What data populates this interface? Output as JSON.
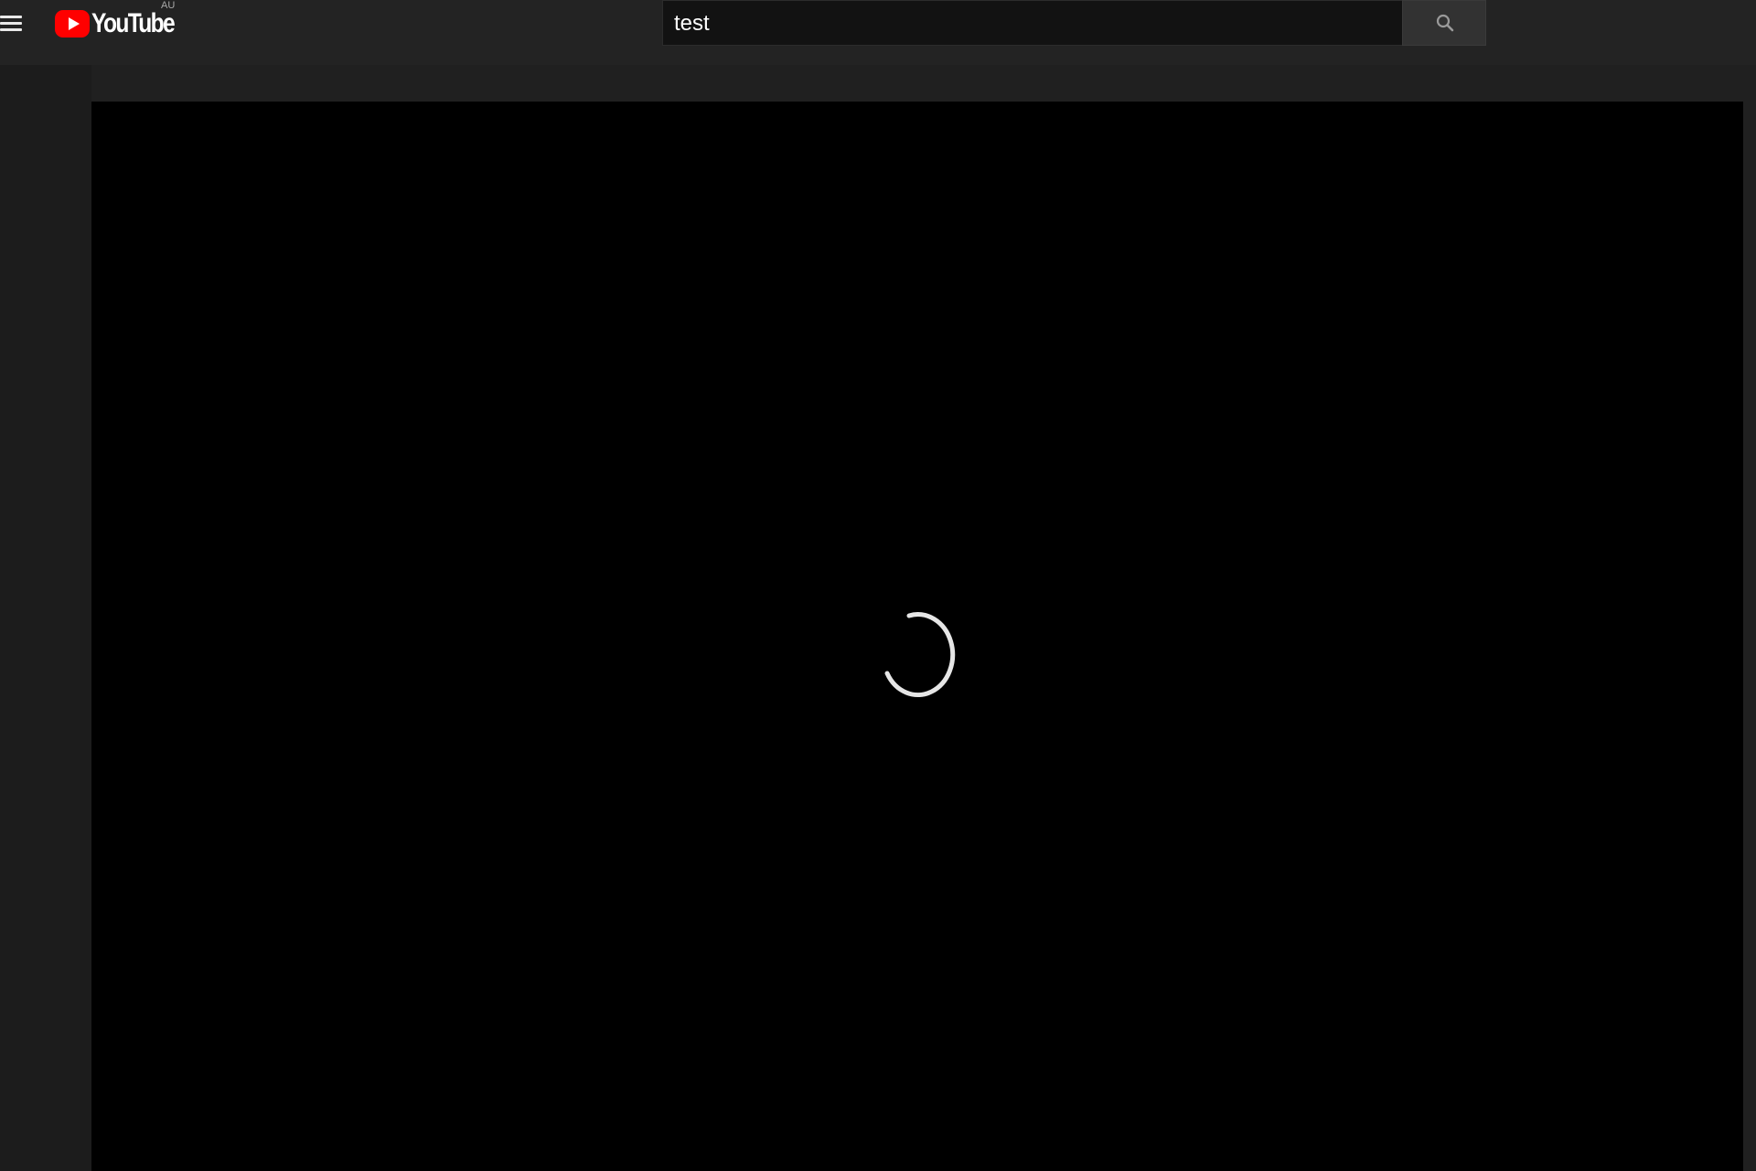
{
  "header": {
    "menu_icon": "hamburger-menu-icon",
    "logo": {
      "text": "YouTube",
      "country_code": "AU",
      "icon": "youtube-play-icon",
      "brand_color": "#ff0000"
    },
    "search": {
      "value": "test",
      "button_icon": "search-icon"
    }
  },
  "player": {
    "state": "loading",
    "spinner_icon": "loading-spinner-icon",
    "background_color": "#000000"
  },
  "colors": {
    "masthead": "#232323",
    "page_background": "#1a1a1a",
    "search_field": "#121212",
    "search_button": "#323232",
    "text": "#ffffff"
  }
}
